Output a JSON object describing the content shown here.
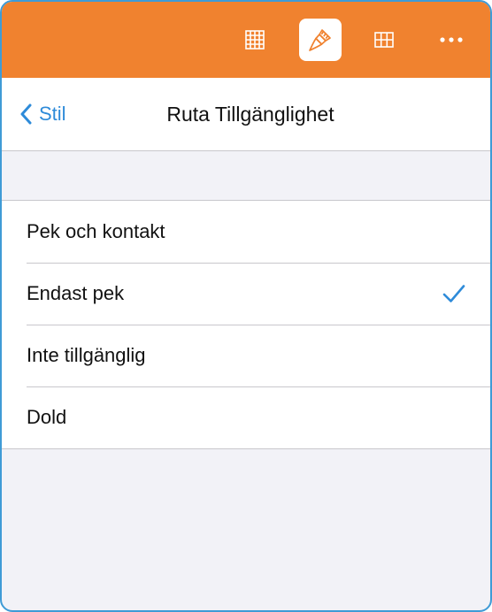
{
  "toolbar": {
    "tools": [
      {
        "icon": "table-grid-icon",
        "active": false
      },
      {
        "icon": "paintbrush-icon",
        "active": true
      },
      {
        "icon": "cell-grid-icon",
        "active": false
      },
      {
        "icon": "more-icon",
        "active": false
      }
    ],
    "colors": {
      "background": "#f0822f",
      "icon": "#ffffff",
      "active_icon": "#f0822f"
    }
  },
  "navbar": {
    "back_label": "Stil",
    "title": "Ruta Tillgänglighet",
    "accent": "#2e8bd9"
  },
  "options": {
    "items": [
      {
        "label": "Pek och kontakt",
        "selected": false
      },
      {
        "label": "Endast pek",
        "selected": true
      },
      {
        "label": "Inte tillgänglig",
        "selected": false
      },
      {
        "label": "Dold",
        "selected": false
      }
    ],
    "check_icon": "checkmark-icon"
  }
}
